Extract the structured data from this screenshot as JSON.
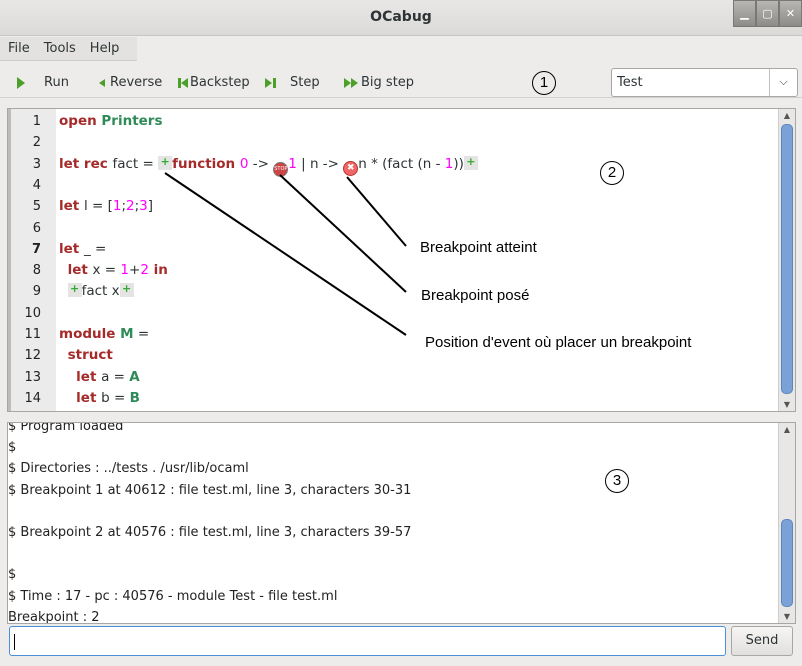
{
  "window": {
    "title": "OCabug",
    "minimize": "▁",
    "maximize": "▢",
    "close": "✕"
  },
  "menu": [
    "File",
    "Tools",
    "Help"
  ],
  "toolbar": {
    "run": "Run",
    "reverse": "Reverse",
    "backstep": "Backstep",
    "step": "Step",
    "bigstep": "Big step"
  },
  "combo": {
    "value": "Test"
  },
  "editor": {
    "line_numbers": [
      "1",
      "2",
      "3",
      "4",
      "5",
      "6",
      "7",
      "8",
      "9",
      "10",
      "11",
      "12",
      "13",
      "14"
    ],
    "lines": [
      [
        {
          "t": "open ",
          "c": "kw"
        },
        {
          "t": "Printers",
          "c": "mod"
        }
      ],
      [],
      [
        {
          "t": "let rec ",
          "c": "kw"
        },
        {
          "t": "fact = ",
          "c": ""
        },
        {
          "t": "+",
          "c": "ev"
        },
        {
          "t": "function ",
          "c": "kw"
        },
        {
          "t": "0",
          "c": "num"
        },
        {
          "t": " -> ",
          "c": ""
        },
        {
          "t": "STOP",
          "c": "stop"
        },
        {
          "t": "1",
          "c": "num"
        },
        {
          "t": " | n -> ",
          "c": ""
        },
        {
          "t": "✖",
          "c": "hit"
        },
        {
          "t": "n * (fact (n - ",
          "c": ""
        },
        {
          "t": "1",
          "c": "num"
        },
        {
          "t": "))",
          "c": ""
        },
        {
          "t": "+",
          "c": "ev"
        }
      ],
      [],
      [
        {
          "t": "let ",
          "c": "kw"
        },
        {
          "t": "l = [",
          "c": ""
        },
        {
          "t": "1",
          "c": "num"
        },
        {
          "t": ";",
          "c": ""
        },
        {
          "t": "2",
          "c": "num"
        },
        {
          "t": ";",
          "c": ""
        },
        {
          "t": "3",
          "c": "num"
        },
        {
          "t": "]",
          "c": ""
        }
      ],
      [],
      [
        {
          "t": "let ",
          "c": "kw"
        },
        {
          "t": "_ =",
          "c": ""
        }
      ],
      [
        {
          "t": "  ",
          "c": ""
        },
        {
          "t": "let ",
          "c": "kw"
        },
        {
          "t": "x = ",
          "c": ""
        },
        {
          "t": "1",
          "c": "num"
        },
        {
          "t": "+",
          "c": ""
        },
        {
          "t": "2",
          "c": "num"
        },
        {
          "t": " in",
          "c": "kw"
        }
      ],
      [
        {
          "t": "  ",
          "c": ""
        },
        {
          "t": "+",
          "c": "ev"
        },
        {
          "t": "fact x",
          "c": ""
        },
        {
          "t": "+",
          "c": "ev"
        }
      ],
      [],
      [
        {
          "t": "module ",
          "c": "kw"
        },
        {
          "t": "M",
          "c": "mod"
        },
        {
          "t": " =",
          "c": ""
        }
      ],
      [
        {
          "t": "  ",
          "c": ""
        },
        {
          "t": "struct",
          "c": "kw"
        }
      ],
      [
        {
          "t": "    ",
          "c": ""
        },
        {
          "t": "let ",
          "c": "kw"
        },
        {
          "t": "a = ",
          "c": ""
        },
        {
          "t": "A",
          "c": "mod"
        }
      ],
      [
        {
          "t": "    ",
          "c": ""
        },
        {
          "t": "let ",
          "c": "kw"
        },
        {
          "t": "b = ",
          "c": ""
        },
        {
          "t": "B",
          "c": "mod"
        }
      ]
    ]
  },
  "console": {
    "lines": [
      "$ Program loaded",
      "$",
      "$ Directories : ../tests . /usr/lib/ocaml",
      "$ Breakpoint 1 at 40612 : file test.ml, line 3, characters 30-31",
      "",
      "$ Breakpoint 2 at 40576 : file test.ml, line 3, characters 39-57",
      "",
      "$",
      "$ Time : 17 - pc : 40576 - module Test - file test.ml",
      "Breakpoint : 2"
    ]
  },
  "input": {
    "value": ""
  },
  "send_label": "Send",
  "annotations": {
    "reached": "Breakpoint atteint",
    "set": "Breakpoint posé",
    "event": "Position d'event où placer un breakpoint",
    "markers": [
      "1",
      "2",
      "3"
    ]
  },
  "colors": {
    "keyword": "#a52a2a",
    "module": "#2e8b57",
    "number": "#ff00ff",
    "scroll_thumb": "#7aa2d6"
  }
}
